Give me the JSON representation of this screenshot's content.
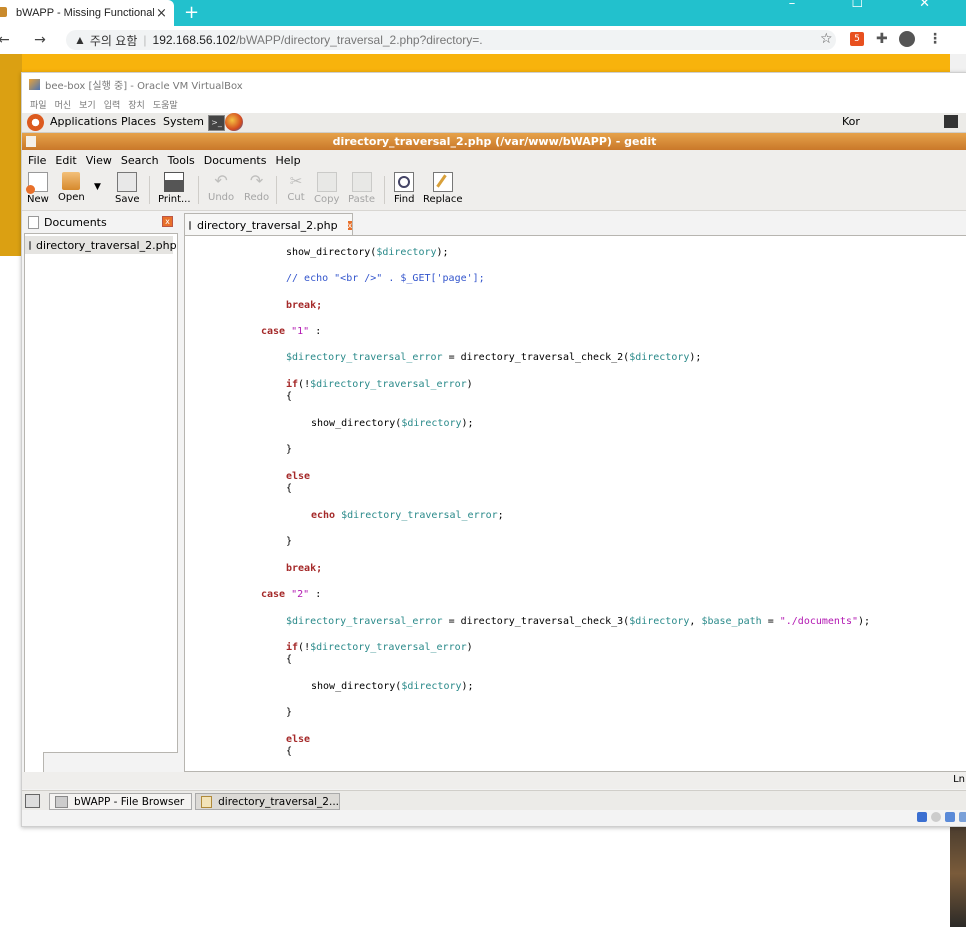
{
  "browser": {
    "tab_title": "bWAPP - Missing Functional Le",
    "tab_close": "×",
    "new_tab": "+",
    "window_controls": "– ☐ ✕",
    "nav": "← → C",
    "security_label": "주의 요함",
    "url_host": "192.168.56.102",
    "url_path": "/bWAPP/directory_traversal_2.php?directory=.",
    "ext_badge": "5"
  },
  "vbox": {
    "title": "bee-box [실행 중] - Oracle VM VirtualBox",
    "menu": [
      "파일",
      "머신",
      "보기",
      "입력",
      "장치",
      "도움말"
    ]
  },
  "gnome_panel": {
    "applications": "Applications",
    "places": "Places",
    "system": "System",
    "keyboard": "Kor"
  },
  "gedit": {
    "title": "directory_traversal_2.php (/var/www/bWAPP) - gedit",
    "menu": [
      "File",
      "Edit",
      "View",
      "Search",
      "Tools",
      "Documents",
      "Help"
    ],
    "toolbar": {
      "new": "New",
      "open": "Open",
      "save": "Save",
      "print": "Print...",
      "undo": "Undo",
      "redo": "Redo",
      "cut": "Cut",
      "copy": "Copy",
      "paste": "Paste",
      "find": "Find",
      "replace": "Replace"
    },
    "side_title": "Documents",
    "side_item": "directory_traversal_2.php",
    "editor_tab": "directory_traversal_2.php",
    "status_ln": "Ln"
  },
  "code": {
    "l1_fn": "show_directory(",
    "l1_var": "$directory",
    "l1_end": ");",
    "l2": "// echo \"<br />\" . $_GET['page'];",
    "l3": "break;",
    "l4_kw": "case",
    "l4_str": "\"1\"",
    "l4_end": " :",
    "l5_var": "$directory_traversal_error",
    "l5_mid": " = directory_traversal_check_2(",
    "l5_var2": "$directory",
    "l5_end": ");",
    "l6_kw": "if",
    "l6_mid": "(!",
    "l6_var": "$directory_traversal_error",
    "l6_end": ")",
    "l7": "{",
    "l8_fn": "show_directory(",
    "l8_var": "$directory",
    "l8_end": ");",
    "l9": "}",
    "l10": "else",
    "l11": "{",
    "l12_kw": "echo",
    "l12_var": "$directory_traversal_error",
    "l12_end": ";",
    "l13": "}",
    "l14": "break;",
    "l15_kw": "case",
    "l15_str": "\"2\"",
    "l15_end": " :",
    "l16_var": "$directory_traversal_error",
    "l16_mid": " = directory_traversal_check_3(",
    "l16_var2": "$directory",
    "l16_comma": ", ",
    "l16_var3": "$base_path",
    "l16_eq": " = ",
    "l16_str": "\"./documents\"",
    "l16_end": ");",
    "l17_kw": "if",
    "l17_mid": "(!",
    "l17_var": "$directory_traversal_error",
    "l17_end": ")",
    "l18": "{",
    "l19_fn": "show_directory(",
    "l19_var": "$directory",
    "l19_end": ");",
    "l20": "}",
    "l21": "else",
    "l22": "{"
  },
  "taskbar": {
    "items": [
      "bWAPP - File Browser",
      "directory_traversal_2..."
    ]
  }
}
